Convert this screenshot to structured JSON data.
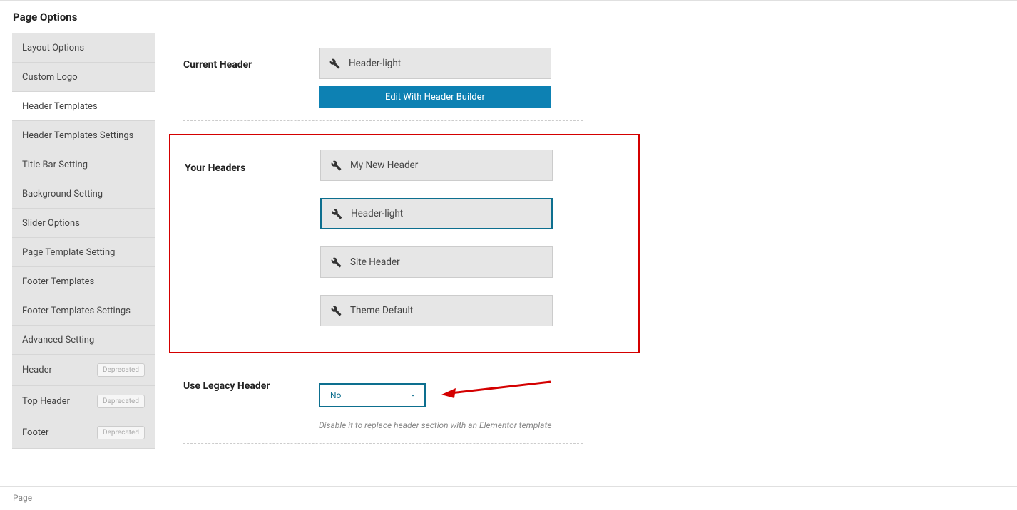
{
  "pageTitle": "Page Options",
  "deprecatedBadge": "Deprecated",
  "sidebar": {
    "items": [
      {
        "label": "Layout Options",
        "active": false,
        "deprecated": false
      },
      {
        "label": "Custom Logo",
        "active": false,
        "deprecated": false
      },
      {
        "label": "Header Templates",
        "active": true,
        "deprecated": false
      },
      {
        "label": "Header Templates Settings",
        "active": false,
        "deprecated": false
      },
      {
        "label": "Title Bar Setting",
        "active": false,
        "deprecated": false
      },
      {
        "label": "Background Setting",
        "active": false,
        "deprecated": false
      },
      {
        "label": "Slider Options",
        "active": false,
        "deprecated": false
      },
      {
        "label": "Page Template Setting",
        "active": false,
        "deprecated": false
      },
      {
        "label": "Footer Templates",
        "active": false,
        "deprecated": false
      },
      {
        "label": "Footer Templates Settings",
        "active": false,
        "deprecated": false
      },
      {
        "label": "Advanced Setting",
        "active": false,
        "deprecated": false
      },
      {
        "label": "Header",
        "active": false,
        "deprecated": true
      },
      {
        "label": "Top Header",
        "active": false,
        "deprecated": true
      },
      {
        "label": "Footer",
        "active": false,
        "deprecated": true
      }
    ]
  },
  "currentHeader": {
    "label": "Current Header",
    "value": "Header-light",
    "editButton": "Edit With Header Builder"
  },
  "yourHeaders": {
    "label": "Your Headers",
    "items": [
      {
        "label": "My New Header",
        "selected": false
      },
      {
        "label": "Header-light",
        "selected": true
      },
      {
        "label": "Site Header",
        "selected": false
      },
      {
        "label": "Theme Default",
        "selected": false
      }
    ]
  },
  "legacy": {
    "label": "Use Legacy Header",
    "value": "No",
    "hint": "Disable it to replace header section with an Elementor template"
  },
  "footerText": "Page",
  "colors": {
    "highlight": "#d40000",
    "accent": "#0d81b3",
    "accentBorder": "#0d6f8f"
  }
}
